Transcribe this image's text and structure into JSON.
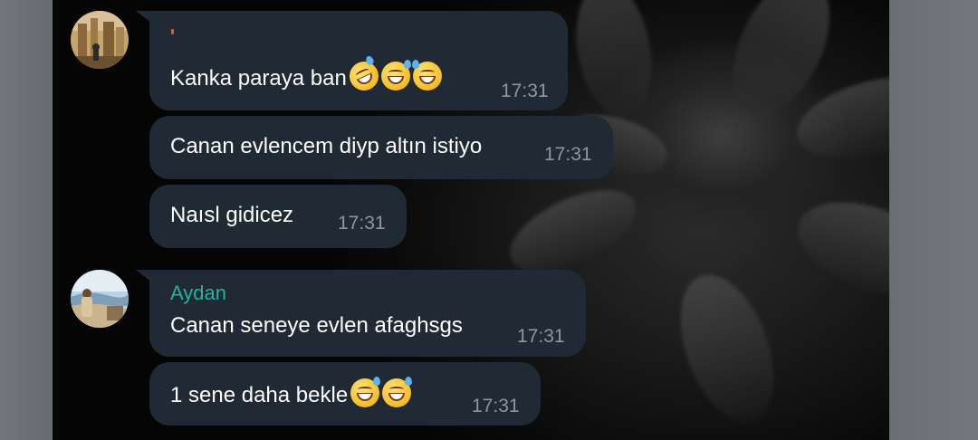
{
  "messages": [
    {
      "sender": "",
      "text": "Kanka paraya ban",
      "emoji": "😂😅😂",
      "time": "17:31"
    },
    {
      "text": "Canan evlencem diyp altın istiyo",
      "time": "17:31"
    },
    {
      "text": "Naısl gidicez",
      "time": "17:31"
    },
    {
      "sender": "Aydan",
      "text": "Canan seneye evlen afaghsgs",
      "time": "17:31"
    },
    {
      "text": "1 sene daha bekle",
      "emoji": "😅😅",
      "time": "17:31"
    }
  ],
  "icons": {
    "avatar_first": "avatar-photo",
    "avatar_second": "avatar-photo",
    "emoji_names": [
      "rolling-on-floor-laughing",
      "grinning-sweat",
      "face-with-tears-of-joy",
      "grinning-sweat",
      "grinning-sweat"
    ]
  },
  "colors": {
    "bubble": "#1f2a34",
    "sender_name": "#27b2a0",
    "timestamp": "#8c97a2",
    "message_text": "#ffffff"
  }
}
